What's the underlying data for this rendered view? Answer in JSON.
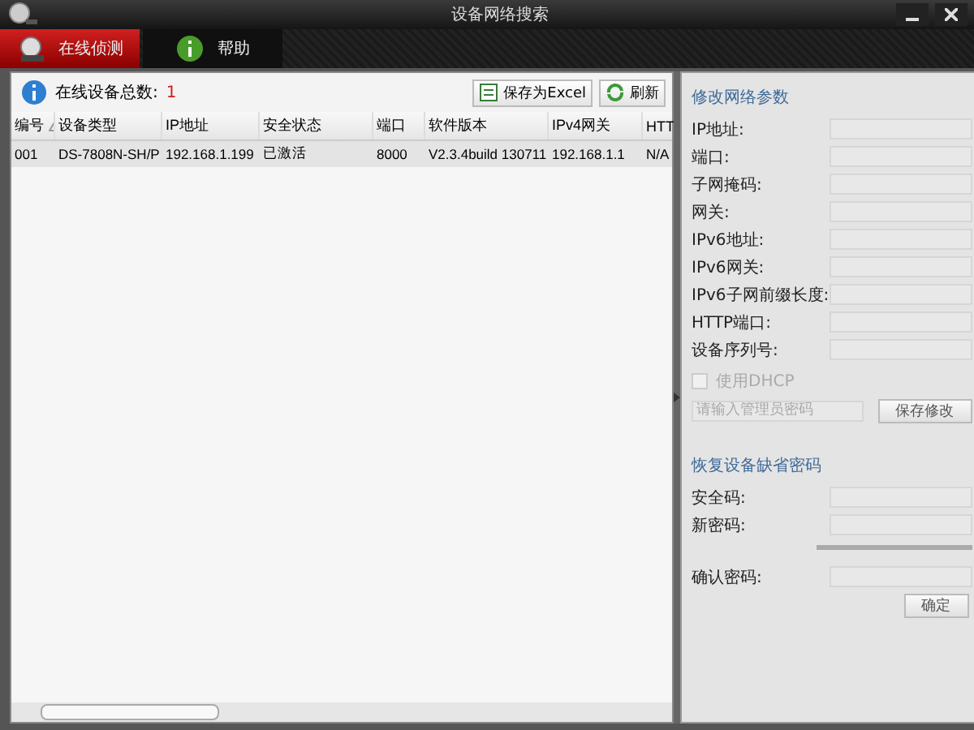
{
  "window": {
    "title": "设备网络搜索"
  },
  "tabs": [
    {
      "label": "在线侦测",
      "selected": true,
      "kind": "search"
    },
    {
      "label": "帮助",
      "selected": false,
      "kind": "help"
    }
  ],
  "device_list": {
    "count_label": "在线设备总数:",
    "count": "1",
    "buttons": [
      {
        "label": "保存为Excel",
        "kind": "excel"
      },
      {
        "label": "刷新",
        "kind": "refresh"
      }
    ],
    "columns": [
      {
        "label": "编号",
        "sorted": true
      },
      {
        "label": "设备类型",
        "sorted": false
      },
      {
        "label": "IP地址",
        "sorted": false
      },
      {
        "label": "安全状态",
        "sorted": false
      },
      {
        "label": "端口",
        "sorted": false
      },
      {
        "label": "软件版本",
        "sorted": false
      },
      {
        "label": "IPv4网关",
        "sorted": false
      },
      {
        "label": "HTT",
        "sorted": false
      }
    ],
    "rows": [
      {
        "selected": true,
        "cells": [
          "001",
          "DS-7808N-SH/P",
          "192.168.1.199",
          "已激活",
          "8000",
          "V2.3.4build 130711",
          "192.168.1.1",
          "N/A"
        ]
      }
    ]
  },
  "network_params": {
    "title": "修改网络参数",
    "fields": [
      {
        "label": "IP地址:"
      },
      {
        "label": "端口:"
      },
      {
        "label": "子网掩码:"
      },
      {
        "label": "网关:"
      },
      {
        "label": "IPv6地址:"
      },
      {
        "label": "IPv6网关:"
      },
      {
        "label": "IPv6子网前缀长度:"
      },
      {
        "label": "HTTP端口:"
      },
      {
        "label": "设备序列号:"
      }
    ],
    "dhcp": {
      "label": "使用DHCP",
      "checked": false
    },
    "password": {
      "placeholder": "请输入管理员密码"
    },
    "save_button": "保存修改"
  },
  "reset_password": {
    "title": "恢复设备缺省密码",
    "fields": [
      {
        "label": "安全码:"
      },
      {
        "label": "新密码:"
      }
    ],
    "confirm_field": {
      "label": "确认密码:"
    },
    "ok_button": "确定"
  }
}
